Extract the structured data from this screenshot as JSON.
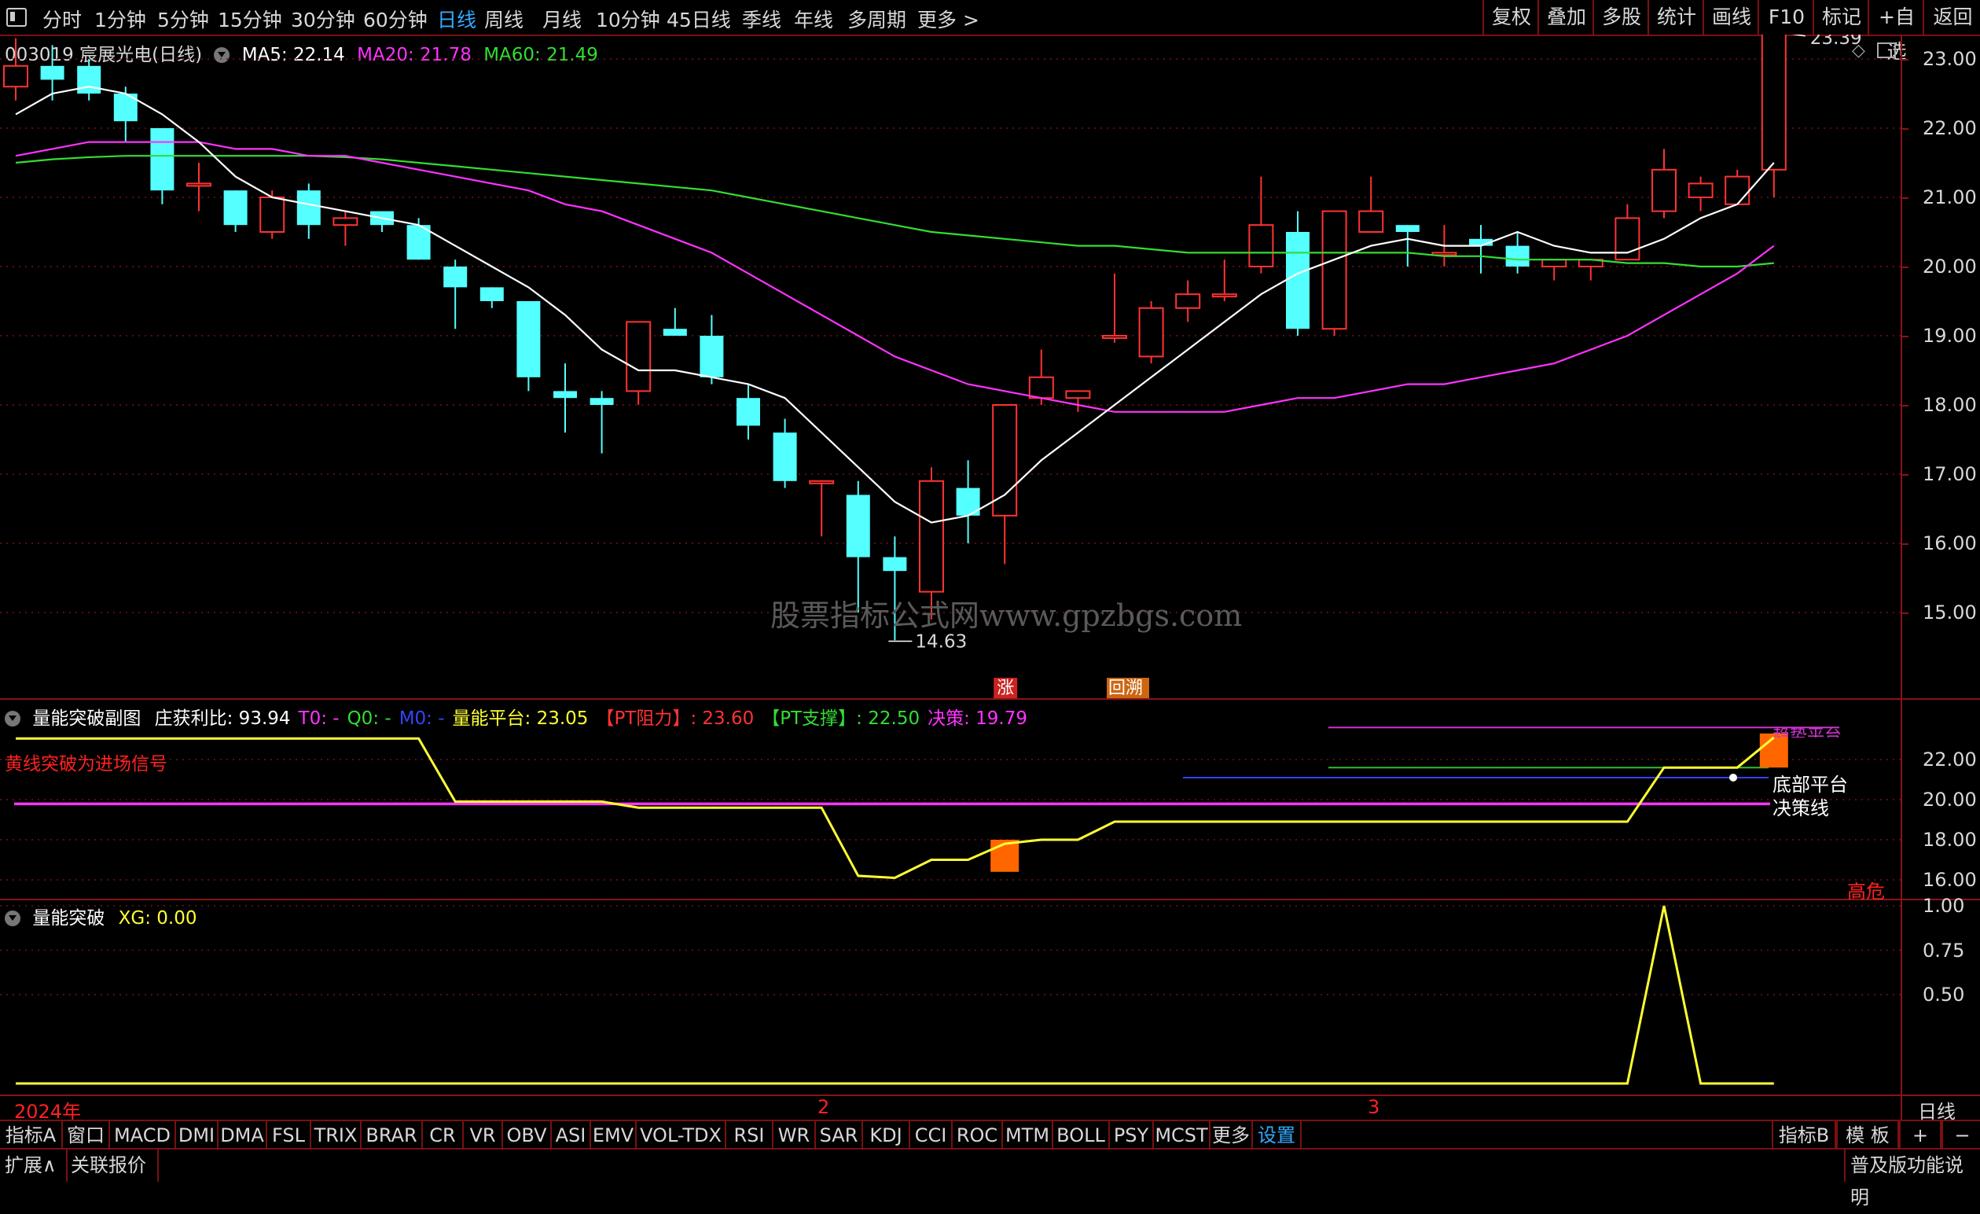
{
  "topbar": {
    "periods": [
      "分时",
      "1分钟",
      "5分钟",
      "15分钟",
      "30分钟",
      "60分钟",
      "日线",
      "周线",
      "月线",
      "10分钟",
      "45日线",
      "季线",
      "年线",
      "多周期",
      "更多 >"
    ],
    "active_period": "日线",
    "right_buttons": [
      "复权",
      "叠加",
      "多股",
      "统计",
      "画线",
      "F10",
      "标记",
      "+自选",
      "返回"
    ]
  },
  "main_legend": {
    "title": "003019 宸展光电(日线)",
    "ma5": "MA5: 22.14",
    "ma20": "MA20: 21.78",
    "ma60": "MA60: 21.49",
    "colors": {
      "ma5": "#ffffff",
      "ma20": "#ff33ff",
      "ma60": "#33dd33"
    }
  },
  "price_axis": [
    "23.00",
    "22.00",
    "21.00",
    "20.00",
    "19.00",
    "18.00",
    "17.00",
    "16.00",
    "15.00"
  ],
  "high_label": "23.39",
  "low_label": "14.63",
  "markers": [
    {
      "text": "涨",
      "color": "#cc2222"
    },
    {
      "text": "回溯",
      "color": "#cc6611"
    }
  ],
  "watermark": "股票指标公式网www.gpzbgs.com",
  "sub1": {
    "name": "量能突破副图",
    "legend": [
      {
        "text": "庄获利比: 93.94",
        "color": "#ffffff"
      },
      {
        "text": "T0: -",
        "color": "#ff33ff"
      },
      {
        "text": "Q0: -",
        "color": "#33dd33"
      },
      {
        "text": "M0: -",
        "color": "#3344ff"
      },
      {
        "text": "量能平台: 23.05",
        "color": "#ffff33"
      },
      {
        "text": "【PT阻力】: 23.60",
        "color": "#ff3333"
      },
      {
        "text": "【PT支撑】: 22.50",
        "color": "#33dd33"
      },
      {
        "text": "决策: 19.79",
        "color": "#ff33ff"
      }
    ],
    "note": "黄线突破为进场信号",
    "axis": [
      "22.00",
      "20.00",
      "18.00",
      "16.00"
    ],
    "labels": {
      "platform": "底部平台",
      "decision": "决策线",
      "risk": "高危",
      "pressure": "趋势平台"
    }
  },
  "sub2": {
    "name": "量能突破",
    "legend": "XG: 0.00",
    "axis": [
      "1.00",
      "0.75",
      "0.50"
    ]
  },
  "time_axis": {
    "labels": [
      "2024年",
      "2",
      "3"
    ],
    "period": "日线"
  },
  "bottom_tabs": [
    "指标A",
    "窗口",
    "MACD",
    "DMI",
    "DMA",
    "FSL",
    "TRIX",
    "BRAR",
    "CR",
    "VR",
    "OBV",
    "ASI",
    "EMV",
    "VOL-TDX",
    "RSI",
    "WR",
    "SAR",
    "KDJ",
    "CCI",
    "ROC",
    "MTM",
    "BOLL",
    "PSY",
    "MCST",
    "更多",
    "设置"
  ],
  "bottom_right": [
    "指标B",
    "模 板",
    "+",
    "−"
  ],
  "status": {
    "left": [
      "扩展∧",
      "关联报价"
    ],
    "right": "普及版功能说明"
  },
  "chart_data": {
    "type": "candlestick",
    "ylim": [
      14.2,
      23.8
    ],
    "candles": [
      {
        "o": 22.6,
        "h": 23.3,
        "l": 22.4,
        "c": 22.9
      },
      {
        "o": 22.9,
        "h": 23.2,
        "l": 22.4,
        "c": 22.7
      },
      {
        "o": 22.9,
        "h": 23.0,
        "l": 22.4,
        "c": 22.5
      },
      {
        "o": 22.5,
        "h": 22.6,
        "l": 21.8,
        "c": 22.1
      },
      {
        "o": 22.0,
        "h": 22.0,
        "l": 20.9,
        "c": 21.1
      },
      {
        "o": 21.2,
        "h": 21.5,
        "l": 20.8,
        "c": 21.2
      },
      {
        "o": 21.1,
        "h": 21.1,
        "l": 20.5,
        "c": 20.6
      },
      {
        "o": 20.5,
        "h": 21.1,
        "l": 20.4,
        "c": 21.0
      },
      {
        "o": 21.1,
        "h": 21.2,
        "l": 20.4,
        "c": 20.6
      },
      {
        "o": 20.6,
        "h": 20.8,
        "l": 20.3,
        "c": 20.7
      },
      {
        "o": 20.8,
        "h": 20.8,
        "l": 20.5,
        "c": 20.6
      },
      {
        "o": 20.6,
        "h": 20.7,
        "l": 20.1,
        "c": 20.1
      },
      {
        "o": 20.0,
        "h": 20.1,
        "l": 19.1,
        "c": 19.7
      },
      {
        "o": 19.7,
        "h": 19.7,
        "l": 19.4,
        "c": 19.5
      },
      {
        "o": 19.5,
        "h": 19.5,
        "l": 18.2,
        "c": 18.4
      },
      {
        "o": 18.2,
        "h": 18.6,
        "l": 17.6,
        "c": 18.1
      },
      {
        "o": 18.1,
        "h": 18.2,
        "l": 17.3,
        "c": 18.0
      },
      {
        "o": 18.2,
        "h": 19.2,
        "l": 18.0,
        "c": 19.2
      },
      {
        "o": 19.1,
        "h": 19.4,
        "l": 19.0,
        "c": 19.0
      },
      {
        "o": 19.0,
        "h": 19.3,
        "l": 18.3,
        "c": 18.4
      },
      {
        "o": 18.1,
        "h": 18.3,
        "l": 17.5,
        "c": 17.7
      },
      {
        "o": 17.6,
        "h": 17.8,
        "l": 16.8,
        "c": 16.9
      },
      {
        "o": 16.9,
        "h": 16.9,
        "l": 16.1,
        "c": 16.9
      },
      {
        "o": 16.7,
        "h": 16.9,
        "l": 15.0,
        "c": 15.8
      },
      {
        "o": 15.8,
        "h": 16.1,
        "l": 14.6,
        "c": 15.6
      },
      {
        "o": 15.3,
        "h": 17.1,
        "l": 14.9,
        "c": 16.9
      },
      {
        "o": 16.8,
        "h": 17.2,
        "l": 16.0,
        "c": 16.4
      },
      {
        "o": 16.4,
        "h": 18.0,
        "l": 15.7,
        "c": 18.0
      },
      {
        "o": 18.1,
        "h": 18.8,
        "l": 18.0,
        "c": 18.4
      },
      {
        "o": 18.1,
        "h": 18.2,
        "l": 17.9,
        "c": 18.2
      },
      {
        "o": 19.0,
        "h": 19.9,
        "l": 18.9,
        "c": 19.0
      },
      {
        "o": 18.7,
        "h": 19.5,
        "l": 18.6,
        "c": 19.4
      },
      {
        "o": 19.4,
        "h": 19.8,
        "l": 19.2,
        "c": 19.6
      },
      {
        "o": 19.6,
        "h": 20.1,
        "l": 19.5,
        "c": 19.6
      },
      {
        "o": 20.0,
        "h": 21.3,
        "l": 19.9,
        "c": 20.6
      },
      {
        "o": 20.5,
        "h": 20.8,
        "l": 19.0,
        "c": 19.1
      },
      {
        "o": 19.1,
        "h": 20.8,
        "l": 19.0,
        "c": 20.8
      },
      {
        "o": 20.5,
        "h": 21.3,
        "l": 20.5,
        "c": 20.8
      },
      {
        "o": 20.6,
        "h": 20.6,
        "l": 20.0,
        "c": 20.5
      },
      {
        "o": 20.2,
        "h": 20.6,
        "l": 20.0,
        "c": 20.2
      },
      {
        "o": 20.4,
        "h": 20.6,
        "l": 19.9,
        "c": 20.3
      },
      {
        "o": 20.3,
        "h": 20.5,
        "l": 19.9,
        "c": 20.0
      },
      {
        "o": 20.0,
        "h": 20.1,
        "l": 19.8,
        "c": 20.1
      },
      {
        "o": 20.0,
        "h": 20.1,
        "l": 19.8,
        "c": 20.1
      },
      {
        "o": 20.1,
        "h": 20.9,
        "l": 20.1,
        "c": 20.7
      },
      {
        "o": 20.8,
        "h": 21.7,
        "l": 20.7,
        "c": 21.4
      },
      {
        "o": 21.0,
        "h": 21.3,
        "l": 20.8,
        "c": 21.2
      },
      {
        "o": 20.9,
        "h": 21.4,
        "l": 20.9,
        "c": 21.3
      },
      {
        "o": 21.4,
        "h": 23.4,
        "l": 21.0,
        "c": 23.4
      }
    ],
    "ma5": [
      22.2,
      22.5,
      22.6,
      22.5,
      22.2,
      21.8,
      21.3,
      21.0,
      20.9,
      20.8,
      20.7,
      20.6,
      20.3,
      20.0,
      19.7,
      19.3,
      18.8,
      18.5,
      18.5,
      18.4,
      18.3,
      18.1,
      17.6,
      17.1,
      16.6,
      16.3,
      16.4,
      16.7,
      17.2,
      17.6,
      18.0,
      18.4,
      18.8,
      19.2,
      19.6,
      19.9,
      20.1,
      20.3,
      20.4,
      20.3,
      20.3,
      20.5,
      20.3,
      20.2,
      20.2,
      20.4,
      20.7,
      20.9,
      21.5
    ],
    "ma20": [
      21.6,
      21.7,
      21.8,
      21.8,
      21.8,
      21.8,
      21.7,
      21.7,
      21.6,
      21.6,
      21.5,
      21.4,
      21.3,
      21.2,
      21.1,
      20.9,
      20.8,
      20.6,
      20.4,
      20.2,
      19.9,
      19.6,
      19.3,
      19.0,
      18.7,
      18.5,
      18.3,
      18.2,
      18.1,
      18.0,
      17.9,
      17.9,
      17.9,
      17.9,
      18.0,
      18.1,
      18.1,
      18.2,
      18.3,
      18.3,
      18.4,
      18.5,
      18.6,
      18.8,
      19.0,
      19.3,
      19.6,
      19.9,
      20.3
    ],
    "ma60": [
      21.5,
      21.55,
      21.58,
      21.6,
      21.6,
      21.6,
      21.6,
      21.6,
      21.6,
      21.58,
      21.55,
      21.5,
      21.45,
      21.4,
      21.35,
      21.3,
      21.25,
      21.2,
      21.15,
      21.1,
      21.0,
      20.9,
      20.8,
      20.7,
      20.6,
      20.5,
      20.45,
      20.4,
      20.35,
      20.3,
      20.3,
      20.25,
      20.2,
      20.2,
      20.2,
      20.2,
      20.2,
      20.2,
      20.2,
      20.15,
      20.15,
      20.1,
      20.1,
      20.1,
      20.05,
      20.05,
      20.0,
      20.0,
      20.05
    ],
    "sub1_platform": [
      23.05,
      23.05,
      23.05,
      23.05,
      23.05,
      23.05,
      23.05,
      23.05,
      23.05,
      23.05,
      23.05,
      23.05,
      19.9,
      19.9,
      19.9,
      19.9,
      19.9,
      19.6,
      19.6,
      19.6,
      19.6,
      19.6,
      19.6,
      16.2,
      16.1,
      17.0,
      17.0,
      17.8,
      18.0,
      18.0,
      18.9,
      18.9,
      18.9,
      18.9,
      18.9,
      18.9,
      18.9,
      18.9,
      18.9,
      18.9,
      18.9,
      18.9,
      18.9,
      18.9,
      18.9,
      21.6,
      21.6,
      21.6,
      23.1
    ],
    "sub1_decision": 19.79,
    "sub2_xg": [
      0,
      0,
      0,
      0,
      0,
      0,
      0,
      0,
      0,
      0,
      0,
      0,
      0,
      0,
      0,
      0,
      0,
      0,
      0,
      0,
      0,
      0,
      0,
      0,
      0,
      0,
      0,
      0,
      0,
      0,
      0,
      0,
      0,
      0,
      0,
      0,
      0,
      0,
      0,
      0,
      0,
      0,
      0,
      0,
      0,
      1,
      0,
      0,
      0
    ]
  }
}
